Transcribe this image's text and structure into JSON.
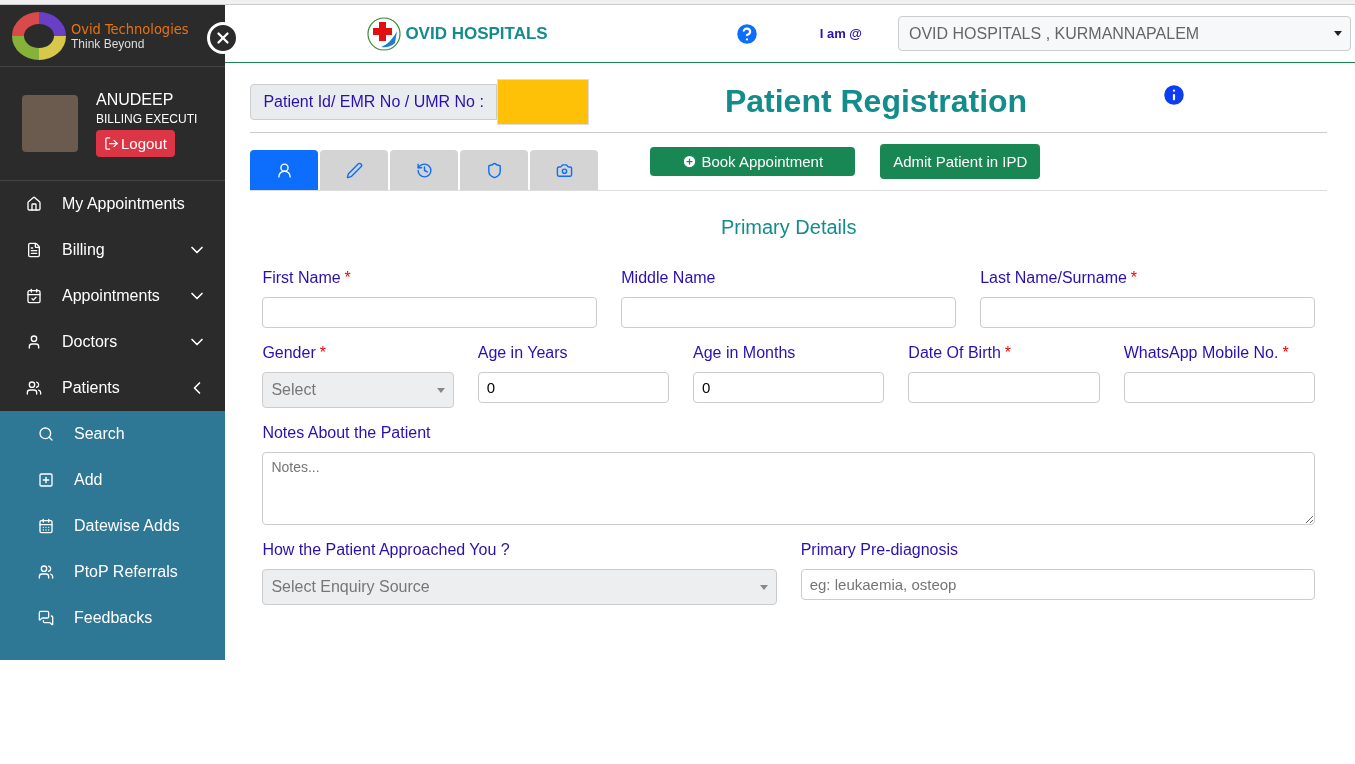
{
  "brand": {
    "name": "Ovid Technologies",
    "tagline": "Think Beyond"
  },
  "user": {
    "name": "ANUDEEP",
    "role": "BILLING EXECUTI",
    "logout": "Logout"
  },
  "nav": [
    {
      "label": "My Appointments",
      "kind": "home"
    },
    {
      "label": "Billing",
      "kind": "bill",
      "expanded": false
    },
    {
      "label": "Appointments",
      "kind": "calendar",
      "expanded": false
    },
    {
      "label": "Doctors",
      "kind": "doctor",
      "expanded": false
    },
    {
      "label": "Patients",
      "kind": "users",
      "expanded": true,
      "children": [
        {
          "label": "Search",
          "kind": "search"
        },
        {
          "label": "Add",
          "kind": "add"
        },
        {
          "label": "Datewise Adds",
          "kind": "calendar"
        },
        {
          "label": "PtoP Referrals",
          "kind": "users"
        },
        {
          "label": "Feedbacks",
          "kind": "chat"
        }
      ]
    }
  ],
  "header": {
    "hospital": "OVID HOSPITALS",
    "location_label": "I am @",
    "location": "OVID HOSPITALS , KURMANNAPALEM"
  },
  "patient_id": {
    "label": "Patient Id/ EMR No / UMR No :"
  },
  "title": "Patient Registration",
  "tabs": [
    {
      "kind": "person",
      "selected": true
    },
    {
      "kind": "pen",
      "selected": false
    },
    {
      "kind": "history",
      "selected": false
    },
    {
      "kind": "shield",
      "selected": false
    },
    {
      "kind": "camera",
      "selected": false
    }
  ],
  "actions": [
    {
      "label": "Book Appointment",
      "kind": "plus"
    },
    {
      "label": "Admit Patient in IPD",
      "kind": "plain"
    }
  ],
  "section": "Primary Details",
  "rows": [
    [
      {
        "label": "First Name",
        "mark": "*",
        "kind": "text"
      },
      {
        "label": "Middle Name",
        "kind": "text"
      },
      {
        "label": "Last Name/Surname",
        "mark": "*",
        "kind": "text"
      }
    ],
    [
      {
        "label": "Gender",
        "mark": "*",
        "kind": "select",
        "placeholder": "Select"
      },
      {
        "label": "Age in Years",
        "kind": "text",
        "value": "0"
      },
      {
        "label": "Age in Months",
        "kind": "text",
        "value": "0"
      },
      {
        "label": "Date Of Birth",
        "mark": "*",
        "kind": "text"
      },
      {
        "label": "WhatsApp Mobile No.",
        "mark": "*",
        "kind": "text"
      }
    ],
    [
      {
        "label": "Notes About the Patient",
        "kind": "textarea",
        "placeholder": "Notes..."
      }
    ],
    [
      {
        "label": "How the Patient Approached You ?",
        "kind": "select",
        "placeholder": "Select Enquiry Source"
      },
      {
        "label": "Primary Pre-diagnosis",
        "kind": "text",
        "placeholder": "eg: leukaemia, osteop"
      }
    ]
  ]
}
